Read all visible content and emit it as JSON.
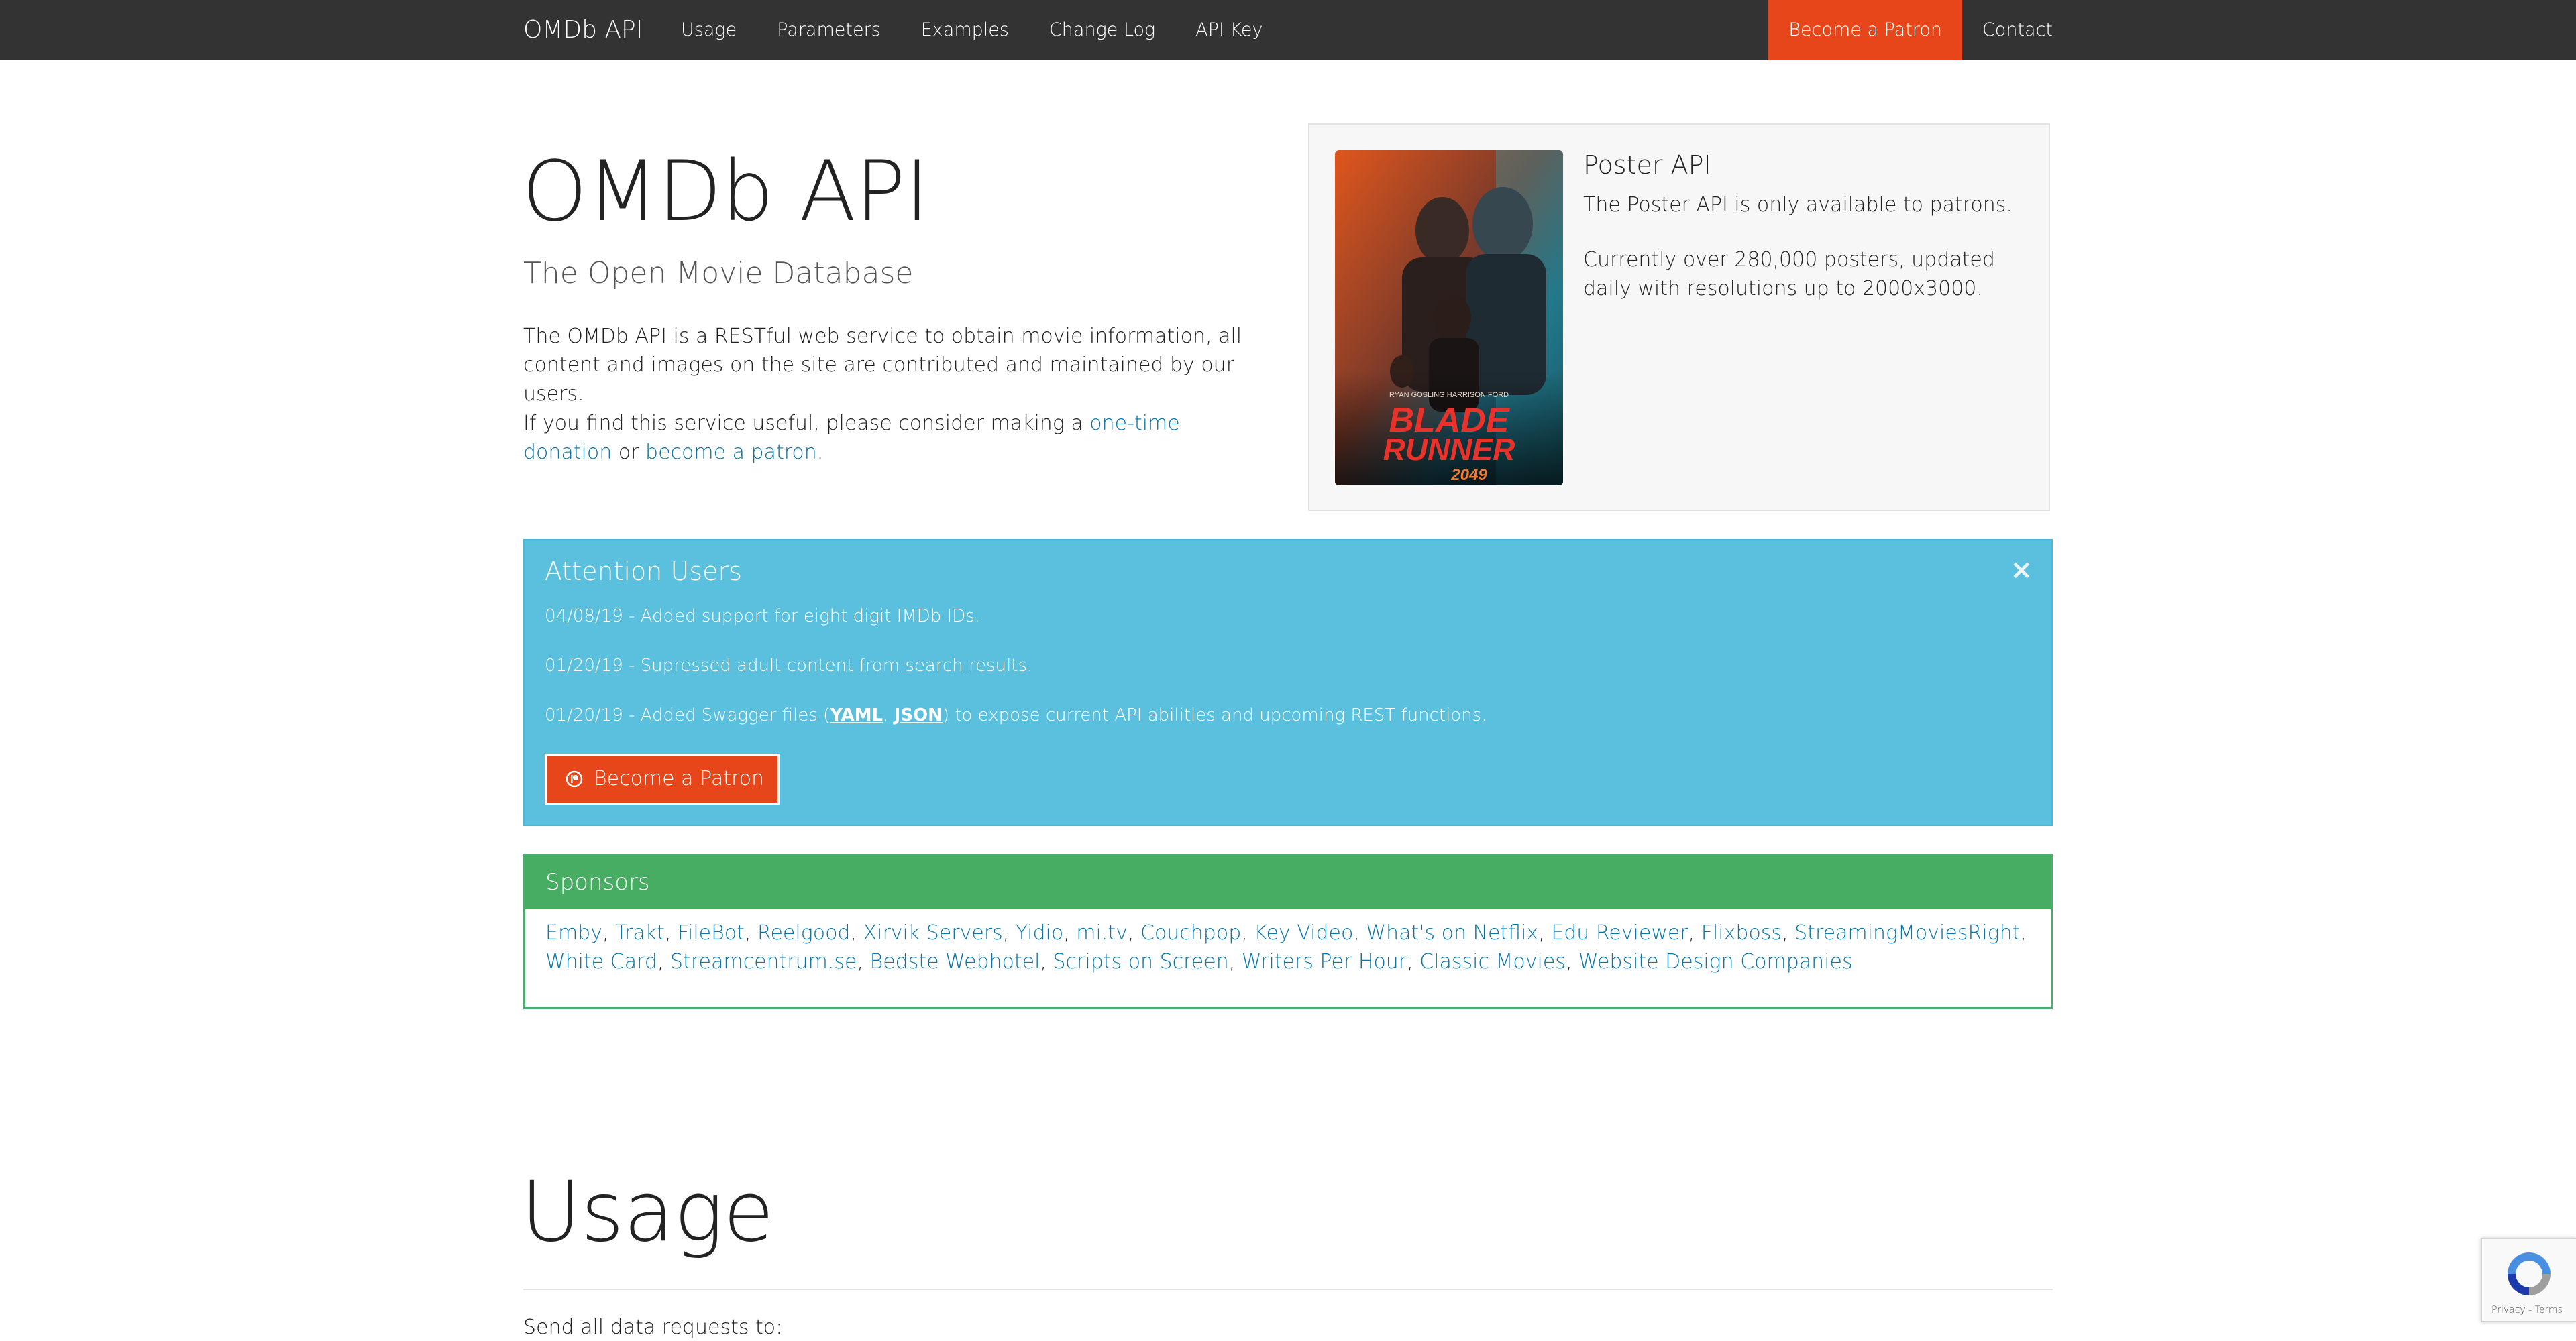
{
  "navbar": {
    "brand": "OMDb API",
    "links": [
      "Usage",
      "Parameters",
      "Examples",
      "Change Log",
      "API Key"
    ],
    "patron": "Become a Patron",
    "contact": "Contact"
  },
  "hero": {
    "title": "OMDb API",
    "subtitle": "The Open Movie Database",
    "description": "The OMDb API is a RESTful web service to obtain movie information, all content and images on the site are contributed and maintained by our users.",
    "donate_prefix": "If you find this service useful, please consider making a ",
    "donate_link": "one-time donation",
    "donate_middle": " or ",
    "patron_link": "become a patron",
    "donate_suffix": "."
  },
  "poster": {
    "title": "Poster API",
    "line1": "The Poster API is only available to patrons.",
    "line2": "Currently over 280,000 posters, updated daily with resolutions up to 2000x3000.",
    "image_top_text": "RYAN GOSLING   HARRISON FORD",
    "image_title_1": "BLADE",
    "image_title_2": "RUNNER",
    "image_title_3": "2049"
  },
  "attention": {
    "title": "Attention Users",
    "close": "×",
    "items": [
      "04/08/19 - Added support for eight digit IMDb IDs.",
      "01/20/19 - Supressed adult content from search results."
    ],
    "swagger_prefix": "01/20/19 - Added Swagger files (",
    "swagger_yaml": "YAML",
    "swagger_sep": ", ",
    "swagger_json": "JSON",
    "swagger_suffix": ") to expose current API abilities and upcoming REST functions.",
    "button": "Become a Patron"
  },
  "sponsors": {
    "title": "Sponsors",
    "list": [
      "Emby",
      "Trakt",
      "FileBot",
      "Reelgood",
      "Xirvik Servers",
      "Yidio",
      "mi.tv",
      "Couchpop",
      "Key Video",
      "What's on Netflix",
      "Edu Reviewer",
      "Flixboss",
      "StreamingMoviesRight",
      "White Card",
      "Streamcentrum.se",
      "Bedste Webhotel",
      "Scripts on Screen",
      "Writers Per Hour",
      "Classic Movies",
      "Website Design Companies"
    ]
  },
  "usage": {
    "title": "Usage",
    "text": "Send all data requests to:"
  },
  "recaptcha": {
    "links": "Privacy - Terms"
  },
  "colors": {
    "navbar": "#333333",
    "accent": "#e6461a",
    "info": "#5bc0de",
    "success": "#47ad63",
    "link": "#0a77a8"
  }
}
